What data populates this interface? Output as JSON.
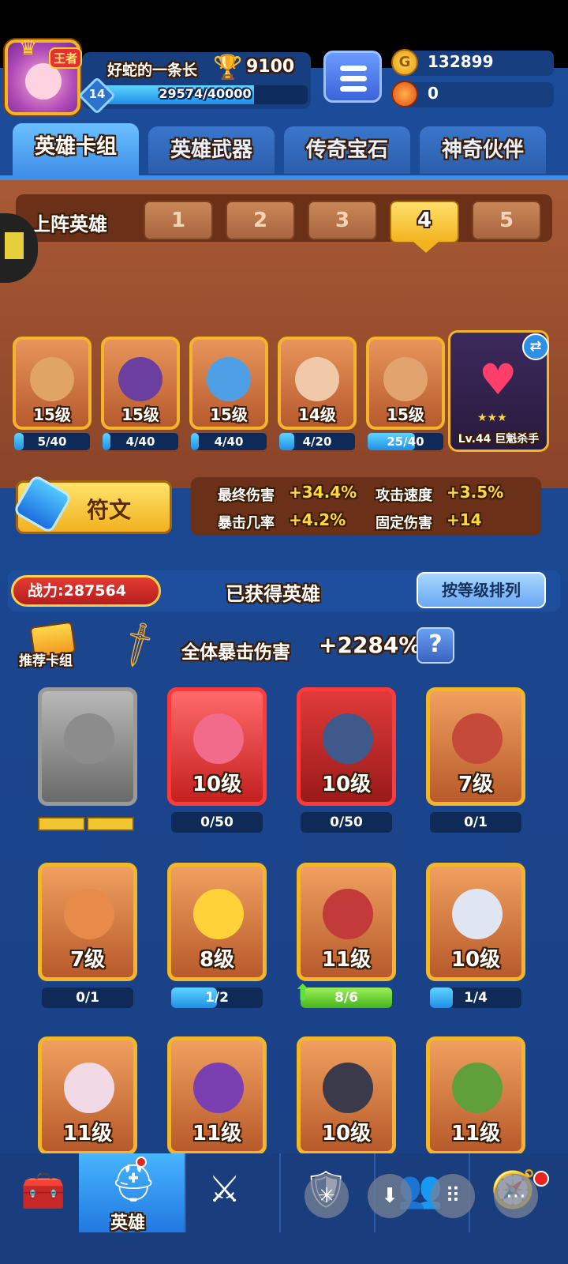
{
  "player": {
    "name": "好蛇的一条长",
    "badge": "王者",
    "level": "14",
    "xp_text": "29574/40000",
    "xp_fraction": 0.739,
    "trophies": "9100"
  },
  "currency": {
    "gold": "132899",
    "gems": "0"
  },
  "tabs": [
    "英雄卡组",
    "英雄武器",
    "传奇宝石",
    "神奇伙伴"
  ],
  "team": {
    "label": "上阵英雄",
    "slots": [
      "1",
      "2",
      "3",
      "4",
      "5"
    ],
    "active_slot": "4",
    "heroes": [
      {
        "level": "15级",
        "progress": "5/40",
        "fill": 0.125
      },
      {
        "level": "15级",
        "progress": "4/40",
        "fill": 0.1
      },
      {
        "level": "15级",
        "progress": "4/40",
        "fill": 0.1
      },
      {
        "level": "14级",
        "progress": "4/20",
        "fill": 0.2
      },
      {
        "level": "15级",
        "progress": "25/40",
        "fill": 0.625
      }
    ],
    "pet": {
      "label": "Lv.44 巨魁杀手",
      "stars": 3
    }
  },
  "rune": {
    "label": "符文"
  },
  "stats": [
    {
      "name": "最终伤害",
      "value": "+34.4%"
    },
    {
      "name": "攻击速度",
      "value": "+3.5%"
    },
    {
      "name": "暴击几率",
      "value": "+4.2%"
    },
    {
      "name": "固定伤害",
      "value": "+14"
    }
  ],
  "owned": {
    "power": "战力:287564",
    "title": "已获得英雄",
    "sort": "按等级排列",
    "recommend": "推荐卡组",
    "crit_label": "全体暴击伤害",
    "crit_value": "+2284%",
    "help": "?"
  },
  "grid": [
    {
      "level": "",
      "progress": "",
      "fill": 0
    },
    {
      "level": "10级",
      "progress": "0/50",
      "fill": 0
    },
    {
      "level": "10级",
      "progress": "0/50",
      "fill": 0
    },
    {
      "level": "7级",
      "progress": "0/1",
      "fill": 0
    },
    {
      "level": "7级",
      "progress": "0/1",
      "fill": 0
    },
    {
      "level": "8级",
      "progress": "1/2",
      "fill": 0.5
    },
    {
      "level": "11级",
      "progress": "8/6",
      "fill": 1
    },
    {
      "level": "10级",
      "progress": "1/4",
      "fill": 0.25
    },
    {
      "level": "11级",
      "progress": "",
      "fill": 0
    },
    {
      "level": "11级",
      "progress": "",
      "fill": 0
    },
    {
      "level": "10级",
      "progress": "",
      "fill": 0
    },
    {
      "level": "11级",
      "progress": "",
      "fill": 0
    }
  ],
  "nav": {
    "active_label": "英雄"
  },
  "colors": {
    "accent": "#3f8fe8",
    "gold": "#f3b52a",
    "panel": "#8a4428"
  }
}
